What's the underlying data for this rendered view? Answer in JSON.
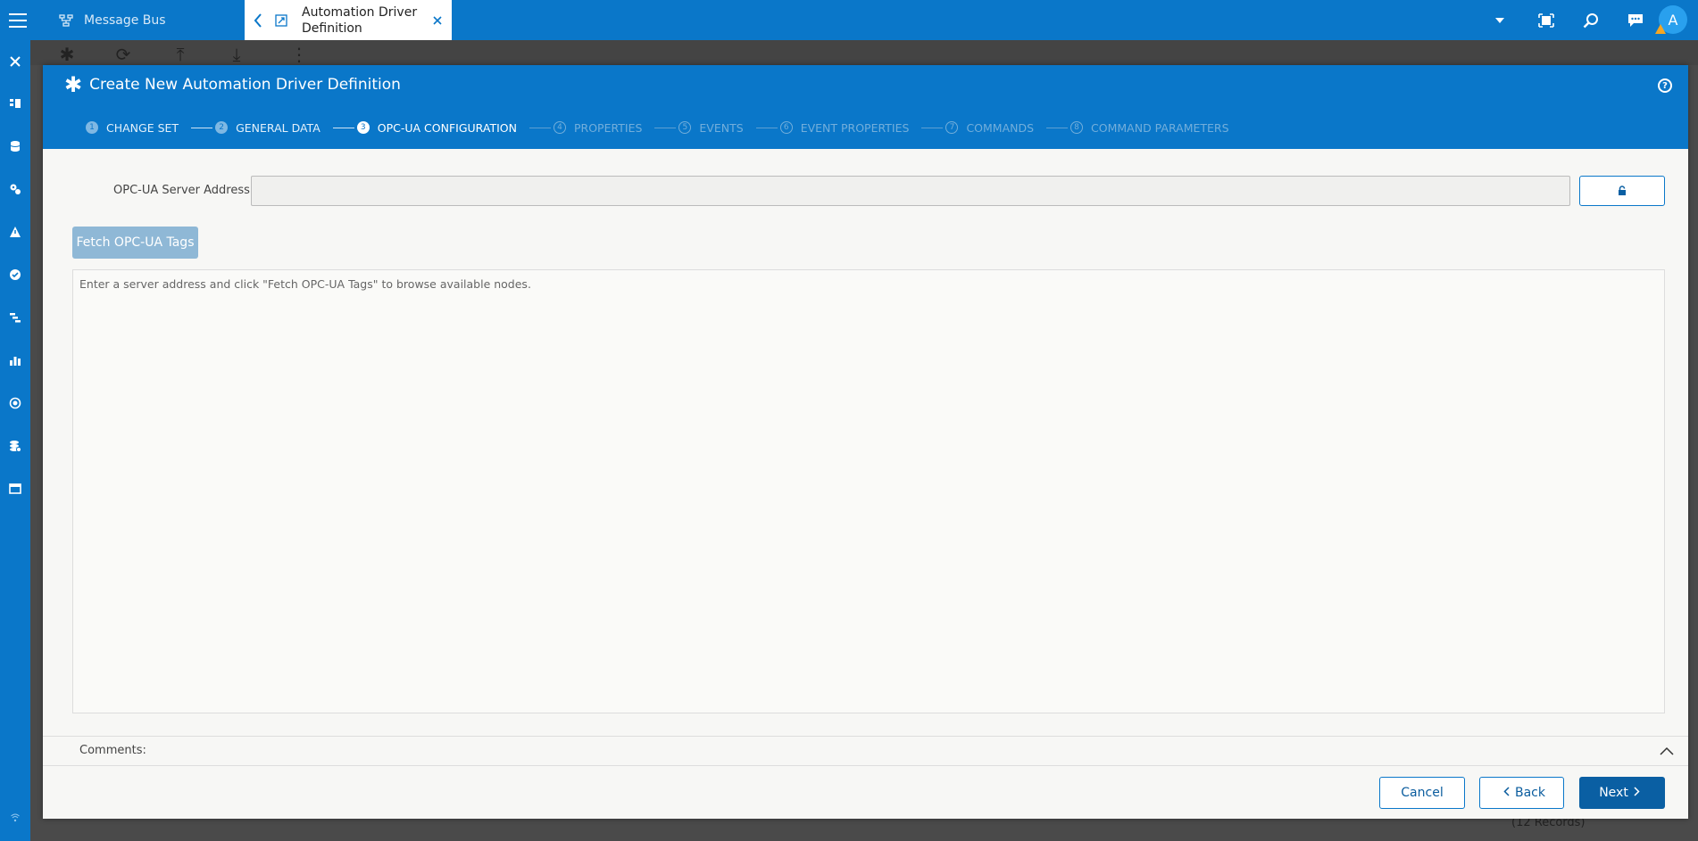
{
  "topbar": {
    "tabs": [
      {
        "label": "Message Bus",
        "icon": "network-icon"
      },
      {
        "label": "Automation Driver Definition",
        "icon": "driver-icon",
        "active": true
      }
    ],
    "avatar_initial": "A",
    "icons": [
      "chevron-down-icon",
      "fullscreen-icon",
      "search-icon",
      "chat-icon"
    ]
  },
  "sidebar": {
    "icons": [
      "close-icon",
      "layers-icon",
      "database-icon",
      "gears-icon",
      "triangle-icon",
      "check-icon",
      "flow-icon",
      "chart-icon",
      "target-icon",
      "stack-icon",
      "window-icon",
      "wifi-icon"
    ]
  },
  "background": {
    "records": "(12 Records)"
  },
  "modal": {
    "title": "Create New Automation Driver Definition",
    "steps": [
      {
        "num": "1",
        "label": "CHANGE SET",
        "state": "done"
      },
      {
        "num": "2",
        "label": "GENERAL DATA",
        "state": "done"
      },
      {
        "num": "3",
        "label": "OPC-UA CONFIGURATION",
        "state": "current"
      },
      {
        "num": "4",
        "label": "PROPERTIES",
        "state": "future"
      },
      {
        "num": "5",
        "label": "EVENTS",
        "state": "future"
      },
      {
        "num": "6",
        "label": "EVENT PROPERTIES",
        "state": "future"
      },
      {
        "num": "7",
        "label": "COMMANDS",
        "state": "future"
      },
      {
        "num": "8",
        "label": "COMMAND PARAMETERS",
        "state": "future"
      }
    ],
    "form": {
      "address_label": "OPC-UA Server Address:",
      "address_value": "",
      "fetch_button": "Fetch OPC-UA Tags",
      "browse_hint": "Enter a server address and click \"Fetch OPC-UA Tags\" to browse available nodes."
    },
    "comments_label": "Comments:",
    "footer": {
      "cancel": "Cancel",
      "back": "Back",
      "next": "Next"
    }
  },
  "colors": {
    "primary": "#0a77c9",
    "button_dark": "#0a5fa3",
    "disabled_button": "#8fb8d6",
    "warning": "#f6a623"
  }
}
